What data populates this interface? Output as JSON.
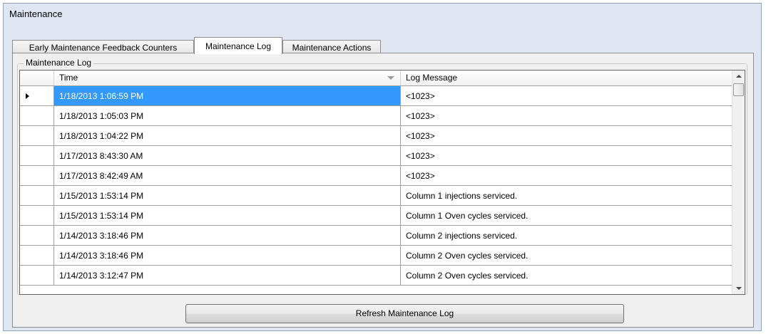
{
  "window": {
    "title": "Maintenance"
  },
  "tabs": [
    {
      "label": "Early Maintenance Feedback Counters"
    },
    {
      "label": "Maintenance Log"
    },
    {
      "label": "Maintenance Actions"
    }
  ],
  "active_tab": "Maintenance Log",
  "group": {
    "label": "Maintenance Log"
  },
  "grid": {
    "columns": [
      {
        "label": "Time",
        "sorted": "descending"
      },
      {
        "label": "Log Message"
      }
    ],
    "selected_row": 0,
    "rows": [
      {
        "time": "1/18/2013 1:06:59 PM",
        "message": "<1023>"
      },
      {
        "time": "1/18/2013 1:05:03 PM",
        "message": "<1023>"
      },
      {
        "time": "1/18/2013 1:04:22 PM",
        "message": "<1023>"
      },
      {
        "time": "1/17/2013 8:43:30 AM",
        "message": "<1023>"
      },
      {
        "time": "1/17/2013 8:42:49 AM",
        "message": "<1023>"
      },
      {
        "time": "1/15/2013 1:53:14 PM",
        "message": "Column 1 injections serviced."
      },
      {
        "time": "1/15/2013 1:53:14 PM",
        "message": "Column 1 Oven cycles serviced."
      },
      {
        "time": "1/14/2013 3:18:46 PM",
        "message": "Column 2 injections serviced."
      },
      {
        "time": "1/14/2013 3:18:46 PM",
        "message": "Column 2 Oven cycles serviced."
      },
      {
        "time": "1/14/2013 3:12:47 PM",
        "message": "Column 2 Oven cycles serviced."
      }
    ]
  },
  "buttons": {
    "refresh_label": "Refresh Maintenance Log"
  },
  "colors": {
    "selection": "#3399ff",
    "window_bg": "#dde6f1",
    "panel_bg": "#f0f0f0"
  }
}
